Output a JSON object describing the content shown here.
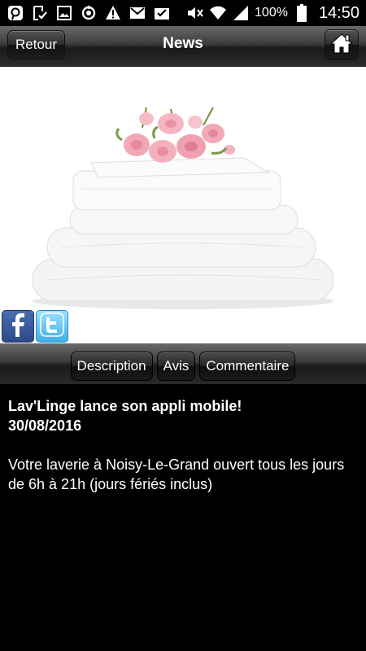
{
  "status_bar": {
    "battery_percent": "100%",
    "time": "14:50",
    "icons": [
      "pinterest-icon",
      "download-check-icon",
      "image-icon",
      "sync-icon",
      "warning-icon",
      "gmail-icon",
      "inbox-check-icon",
      "mute-icon",
      "wifi-icon",
      "signal-icon",
      "battery-icon"
    ]
  },
  "navbar": {
    "back_label": "Retour",
    "title": "News",
    "home_icon": "home-icon"
  },
  "social": {
    "facebook_icon": "facebook-icon",
    "twitter_icon": "twitter-icon"
  },
  "tabs": [
    {
      "label": "Description"
    },
    {
      "label": "Avis"
    },
    {
      "label": "Commentaire"
    }
  ],
  "article": {
    "headline": "Lav'Linge lance son appli mobile!",
    "date": "30/08/2016",
    "body": "Votre laverie à Noisy-Le-Grand ouvert tous les jours de 6h à 21h (jours fériés inclus)"
  }
}
